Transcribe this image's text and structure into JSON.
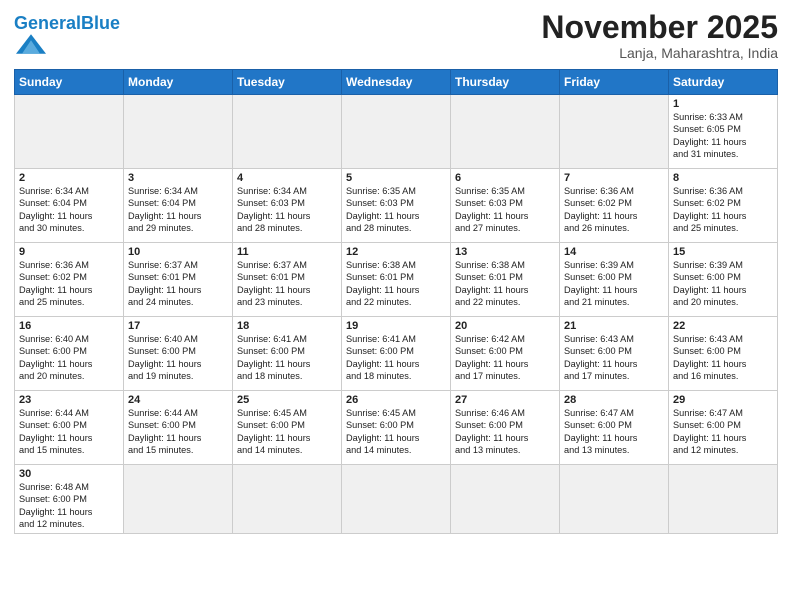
{
  "header": {
    "logo_general": "General",
    "logo_blue": "Blue",
    "month": "November 2025",
    "location": "Lanja, Maharashtra, India"
  },
  "weekdays": [
    "Sunday",
    "Monday",
    "Tuesday",
    "Wednesday",
    "Thursday",
    "Friday",
    "Saturday"
  ],
  "weeks": [
    [
      {
        "day": "",
        "info": ""
      },
      {
        "day": "",
        "info": ""
      },
      {
        "day": "",
        "info": ""
      },
      {
        "day": "",
        "info": ""
      },
      {
        "day": "",
        "info": ""
      },
      {
        "day": "",
        "info": ""
      },
      {
        "day": "1",
        "info": "Sunrise: 6:33 AM\nSunset: 6:05 PM\nDaylight: 11 hours\nand 31 minutes."
      }
    ],
    [
      {
        "day": "2",
        "info": "Sunrise: 6:34 AM\nSunset: 6:04 PM\nDaylight: 11 hours\nand 30 minutes."
      },
      {
        "day": "3",
        "info": "Sunrise: 6:34 AM\nSunset: 6:04 PM\nDaylight: 11 hours\nand 29 minutes."
      },
      {
        "day": "4",
        "info": "Sunrise: 6:34 AM\nSunset: 6:03 PM\nDaylight: 11 hours\nand 28 minutes."
      },
      {
        "day": "5",
        "info": "Sunrise: 6:35 AM\nSunset: 6:03 PM\nDaylight: 11 hours\nand 28 minutes."
      },
      {
        "day": "6",
        "info": "Sunrise: 6:35 AM\nSunset: 6:03 PM\nDaylight: 11 hours\nand 27 minutes."
      },
      {
        "day": "7",
        "info": "Sunrise: 6:36 AM\nSunset: 6:02 PM\nDaylight: 11 hours\nand 26 minutes."
      },
      {
        "day": "8",
        "info": "Sunrise: 6:36 AM\nSunset: 6:02 PM\nDaylight: 11 hours\nand 25 minutes."
      }
    ],
    [
      {
        "day": "9",
        "info": "Sunrise: 6:36 AM\nSunset: 6:02 PM\nDaylight: 11 hours\nand 25 minutes."
      },
      {
        "day": "10",
        "info": "Sunrise: 6:37 AM\nSunset: 6:01 PM\nDaylight: 11 hours\nand 24 minutes."
      },
      {
        "day": "11",
        "info": "Sunrise: 6:37 AM\nSunset: 6:01 PM\nDaylight: 11 hours\nand 23 minutes."
      },
      {
        "day": "12",
        "info": "Sunrise: 6:38 AM\nSunset: 6:01 PM\nDaylight: 11 hours\nand 22 minutes."
      },
      {
        "day": "13",
        "info": "Sunrise: 6:38 AM\nSunset: 6:01 PM\nDaylight: 11 hours\nand 22 minutes."
      },
      {
        "day": "14",
        "info": "Sunrise: 6:39 AM\nSunset: 6:00 PM\nDaylight: 11 hours\nand 21 minutes."
      },
      {
        "day": "15",
        "info": "Sunrise: 6:39 AM\nSunset: 6:00 PM\nDaylight: 11 hours\nand 20 minutes."
      }
    ],
    [
      {
        "day": "16",
        "info": "Sunrise: 6:40 AM\nSunset: 6:00 PM\nDaylight: 11 hours\nand 20 minutes."
      },
      {
        "day": "17",
        "info": "Sunrise: 6:40 AM\nSunset: 6:00 PM\nDaylight: 11 hours\nand 19 minutes."
      },
      {
        "day": "18",
        "info": "Sunrise: 6:41 AM\nSunset: 6:00 PM\nDaylight: 11 hours\nand 18 minutes."
      },
      {
        "day": "19",
        "info": "Sunrise: 6:41 AM\nSunset: 6:00 PM\nDaylight: 11 hours\nand 18 minutes."
      },
      {
        "day": "20",
        "info": "Sunrise: 6:42 AM\nSunset: 6:00 PM\nDaylight: 11 hours\nand 17 minutes."
      },
      {
        "day": "21",
        "info": "Sunrise: 6:43 AM\nSunset: 6:00 PM\nDaylight: 11 hours\nand 17 minutes."
      },
      {
        "day": "22",
        "info": "Sunrise: 6:43 AM\nSunset: 6:00 PM\nDaylight: 11 hours\nand 16 minutes."
      }
    ],
    [
      {
        "day": "23",
        "info": "Sunrise: 6:44 AM\nSunset: 6:00 PM\nDaylight: 11 hours\nand 15 minutes."
      },
      {
        "day": "24",
        "info": "Sunrise: 6:44 AM\nSunset: 6:00 PM\nDaylight: 11 hours\nand 15 minutes."
      },
      {
        "day": "25",
        "info": "Sunrise: 6:45 AM\nSunset: 6:00 PM\nDaylight: 11 hours\nand 14 minutes."
      },
      {
        "day": "26",
        "info": "Sunrise: 6:45 AM\nSunset: 6:00 PM\nDaylight: 11 hours\nand 14 minutes."
      },
      {
        "day": "27",
        "info": "Sunrise: 6:46 AM\nSunset: 6:00 PM\nDaylight: 11 hours\nand 13 minutes."
      },
      {
        "day": "28",
        "info": "Sunrise: 6:47 AM\nSunset: 6:00 PM\nDaylight: 11 hours\nand 13 minutes."
      },
      {
        "day": "29",
        "info": "Sunrise: 6:47 AM\nSunset: 6:00 PM\nDaylight: 11 hours\nand 12 minutes."
      }
    ],
    [
      {
        "day": "30",
        "info": "Sunrise: 6:48 AM\nSunset: 6:00 PM\nDaylight: 11 hours\nand 12 minutes."
      },
      {
        "day": "",
        "info": ""
      },
      {
        "day": "",
        "info": ""
      },
      {
        "day": "",
        "info": ""
      },
      {
        "day": "",
        "info": ""
      },
      {
        "day": "",
        "info": ""
      },
      {
        "day": "",
        "info": ""
      }
    ]
  ]
}
